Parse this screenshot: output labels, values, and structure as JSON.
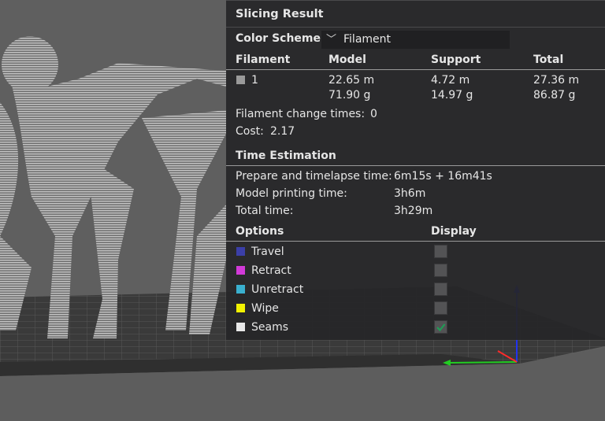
{
  "panel": {
    "title": "Slicing Result",
    "color_scheme_label": "Color Scheme",
    "color_scheme_value": "Filament",
    "filament_table": {
      "headers": [
        "Filament",
        "Model",
        "Support",
        "Total"
      ],
      "rows": [
        {
          "swatch_color": "#9a9a9a",
          "id": "1",
          "model_length": "22.65 m",
          "model_weight": "71.90 g",
          "support_length": "4.72 m",
          "support_weight": "14.97 g",
          "total_length": "27.36 m",
          "total_weight": "86.87 g"
        }
      ]
    },
    "filament_change_label": "Filament change times:",
    "filament_change_value": "0",
    "cost_label": "Cost:",
    "cost_value": "2.17",
    "time_estimation_title": "Time Estimation",
    "times": [
      {
        "label": "Prepare and timelapse time:",
        "value": "6m15s + 16m41s"
      },
      {
        "label": "Model printing time:",
        "value": "3h6m"
      },
      {
        "label": "Total time:",
        "value": "3h29m"
      }
    ],
    "options_header": "Options",
    "display_header": "Display",
    "options": [
      {
        "label": "Travel",
        "color": "#3b3fa8",
        "checked": false
      },
      {
        "label": "Retract",
        "color": "#d23ad8",
        "checked": false
      },
      {
        "label": "Unretract",
        "color": "#3ab0cf",
        "checked": false
      },
      {
        "label": "Wipe",
        "color": "#f1f100",
        "checked": false
      },
      {
        "label": "Seams",
        "color": "#e8e8e8",
        "checked": true
      }
    ]
  },
  "colors": {
    "panel_bg": "#262628",
    "accent_check": "#1f9d55",
    "axis_x": "#ff2a2a",
    "axis_y": "#22cc22",
    "axis_z": "#2233ee"
  }
}
